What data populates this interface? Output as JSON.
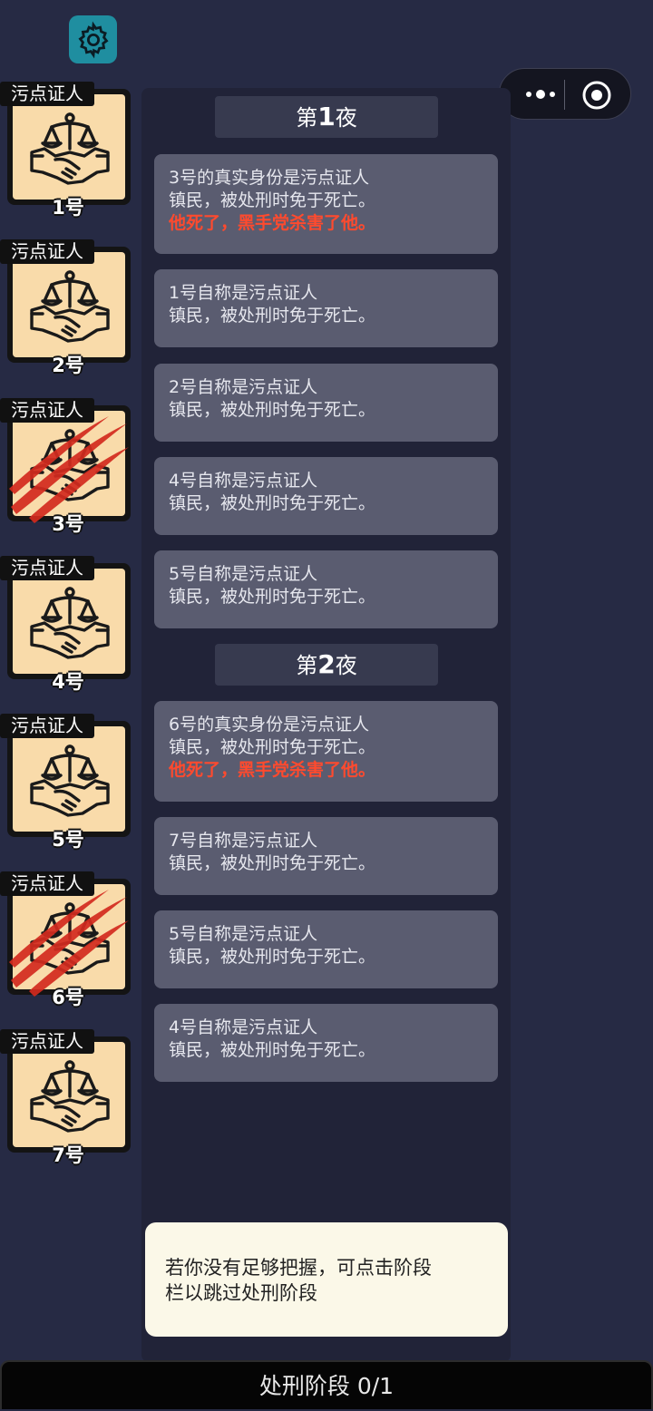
{
  "top_bar": {
    "settings_icon": "gear-icon",
    "menu_icon": "more-dots-icon",
    "close_icon": "target-circle-icon"
  },
  "players": [
    {
      "role": "污点证人",
      "number": "1号",
      "dead": false
    },
    {
      "role": "污点证人",
      "number": "2号",
      "dead": false
    },
    {
      "role": "污点证人",
      "number": "3号",
      "dead": true
    },
    {
      "role": "污点证人",
      "number": "4号",
      "dead": false
    },
    {
      "role": "污点证人",
      "number": "5号",
      "dead": false
    },
    {
      "role": "污点证人",
      "number": "6号",
      "dead": true
    },
    {
      "role": "污点证人",
      "number": "7号",
      "dead": false
    }
  ],
  "nights": [
    {
      "prefix": "第",
      "num": "1",
      "suffix": "夜"
    },
    {
      "prefix": "第",
      "num": "2",
      "suffix": "夜"
    }
  ],
  "messages": [
    {
      "line1": "3号的真实身份是污点证人",
      "line2": "镇民，被处刑时免于死亡。",
      "death": "他死了，黑手党杀害了他。"
    },
    {
      "line1": "1号自称是污点证人",
      "line2": "镇民，被处刑时免于死亡。"
    },
    {
      "line1": "2号自称是污点证人",
      "line2": "镇民，被处刑时免于死亡。"
    },
    {
      "line1": "4号自称是污点证人",
      "line2": "镇民，被处刑时免于死亡。"
    },
    {
      "line1": "5号自称是污点证人",
      "line2": "镇民，被处刑时免于死亡。"
    },
    {
      "line1": "6号的真实身份是污点证人",
      "line2": "镇民，被处刑时免于死亡。",
      "death": "他死了，黑手党杀害了他。"
    },
    {
      "line1": "7号自称是污点证人",
      "line2": "镇民，被处刑时免于死亡。"
    },
    {
      "line1": "5号自称是污点证人",
      "line2": "镇民，被处刑时免于死亡。"
    },
    {
      "line1": "4号自称是污点证人",
      "line2": "镇民，被处刑时免于死亡。"
    }
  ],
  "tip": {
    "line1": "若你没有足够把握，可点击阶段",
    "line2": "栏以跳过处刑阶段"
  },
  "phase_bar": {
    "label": "处刑阶段 0/1"
  },
  "colors": {
    "death_text": "#ff4a2e",
    "card_bg": "#f9dbaa",
    "tip_bg": "#fbf8e8",
    "scratch": "#d22a1e"
  }
}
